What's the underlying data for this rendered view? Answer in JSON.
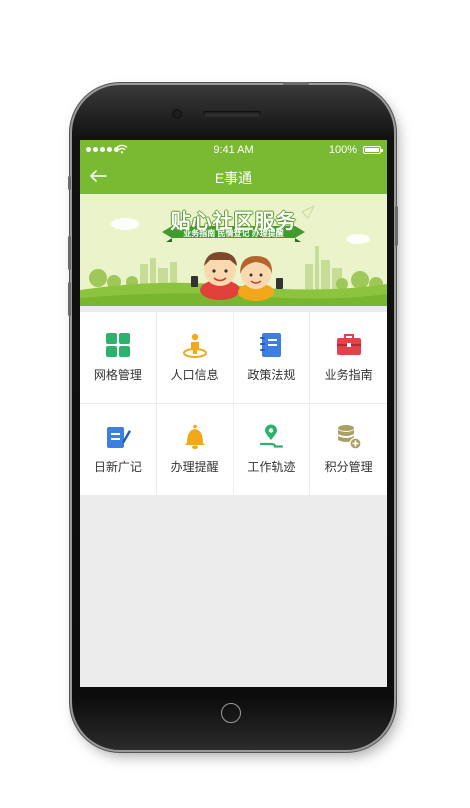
{
  "status_bar": {
    "time": "9:41 AM",
    "battery": "100%"
  },
  "nav": {
    "title": "E事通"
  },
  "banner": {
    "headline": "贴心社区服务",
    "ribbon": "业务指南 民情登记 办理提醒"
  },
  "grid": {
    "items": [
      {
        "label": "网格管理",
        "icon": "grid-icon",
        "color": "#2db26d"
      },
      {
        "label": "人口信息",
        "icon": "person-location-icon",
        "color": "#f3a81c"
      },
      {
        "label": "政策法规",
        "icon": "notebook-icon",
        "color": "#3d7fe0"
      },
      {
        "label": "业务指南",
        "icon": "briefcase-icon",
        "color": "#e0434a"
      },
      {
        "label": "日新广记",
        "icon": "clipboard-pen-icon",
        "color": "#3d7fe0"
      },
      {
        "label": "办理提醒",
        "icon": "bell-icon",
        "color": "#f3a81c"
      },
      {
        "label": "工作轨迹",
        "icon": "route-pin-icon",
        "color": "#2db26d"
      },
      {
        "label": "积分管理",
        "icon": "coin-stack-icon",
        "color": "#a9a061"
      }
    ]
  },
  "colors": {
    "primary": "#7ab932",
    "background": "#ececec"
  }
}
